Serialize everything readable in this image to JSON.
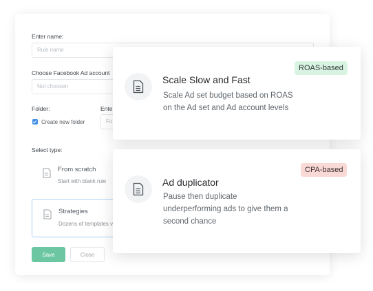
{
  "form": {
    "name_label": "Enter name:",
    "name_placeholder": "Rule name",
    "account_label": "Choose Facebook Ad account",
    "account_placeholder": "Not choosen",
    "folder_label": "Folder:",
    "enter_label": "Ente",
    "create_folder_label": "Create new folder",
    "folder_input_partial": "Fo",
    "type_label": "Select type:",
    "types": [
      {
        "title": "From scratch",
        "subtitle": "Start with blank rule"
      },
      {
        "title": "Strategies",
        "subtitle": "Dozens of templates v"
      }
    ],
    "save_label": "Save",
    "close_label": "Close"
  },
  "features": [
    {
      "title": "Scale Slow and Fast",
      "description": [
        "Scale Ad set budget based on ROAS",
        "on the Ad set and Ad account levels"
      ],
      "badge": "ROAS-based",
      "badge_color": "#d9f3e3"
    },
    {
      "title": "Ad duplicator",
      "description": [
        "Pause then duplicate",
        "underperforming ads to give them a",
        "second chance"
      ],
      "badge": "CPA-based",
      "badge_color": "#f9d9d6"
    }
  ],
  "icons": [
    "document-icon"
  ]
}
